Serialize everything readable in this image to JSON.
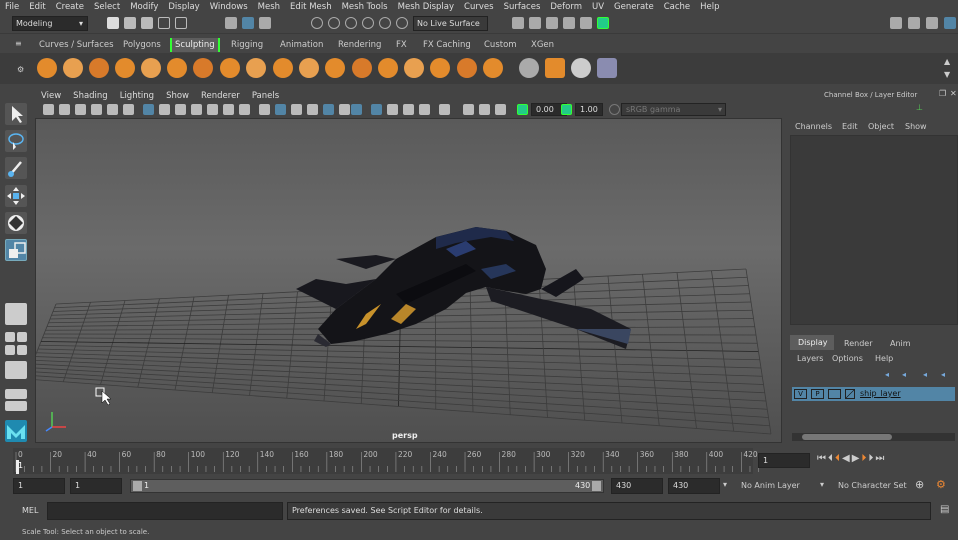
{
  "menu": [
    "File",
    "Edit",
    "Create",
    "Select",
    "Modify",
    "Display",
    "Windows",
    "Mesh",
    "Edit Mesh",
    "Mesh Tools",
    "Mesh Display",
    "Curves",
    "Surfaces",
    "Deform",
    "UV",
    "Generate",
    "Cache",
    "Help"
  ],
  "status": {
    "mode": "Modeling",
    "live_surface": "No Live Surface"
  },
  "shelf_tabs": [
    "Curves / Surfaces",
    "Polygons",
    "Sculpting",
    "Rigging",
    "Animation",
    "Rendering",
    "FX",
    "FX Caching",
    "Custom",
    "XGen"
  ],
  "active_shelf_tab": "Sculpting",
  "panel_menu": [
    "View",
    "Shading",
    "Lighting",
    "Show",
    "Renderer",
    "Panels"
  ],
  "panel_toolbar": {
    "value_a": "0.00",
    "value_b": "1.00",
    "color_space": "sRGB gamma"
  },
  "viewport": {
    "camera_label": "persp"
  },
  "channel_box": {
    "title": "Channel Box / Layer Editor",
    "menu": [
      "Channels",
      "Edit",
      "Object",
      "Show"
    ],
    "tabs": [
      "Display",
      "Render",
      "Anim"
    ],
    "active_tab": "Display",
    "layer_menu": [
      "Layers",
      "Options",
      "Help"
    ],
    "layer": {
      "v": "V",
      "p": "P",
      "name": "ship_layer"
    }
  },
  "timeline": {
    "ticks": [
      "0",
      "20",
      "40",
      "60",
      "80",
      "100",
      "120",
      "140",
      "160",
      "180",
      "200",
      "220",
      "240",
      "260",
      "280",
      "300",
      "320",
      "340",
      "360",
      "380",
      "400",
      "420"
    ],
    "current_frame": "1",
    "frame_field": "1"
  },
  "range": {
    "start": "1",
    "playback_start": "1",
    "slider_start": "1",
    "slider_end": "430",
    "playback_end": "430",
    "end": "430",
    "anim_layer": "No Anim Layer",
    "char_set": "No Character Set"
  },
  "command": {
    "label": "MEL",
    "result": "Preferences saved. See Script Editor for details."
  },
  "help": {
    "text": "Scale Tool: Select an object to scale."
  },
  "colors": {
    "accent_blue": "#5285a6",
    "active_green": "#33ff33",
    "shelf_orange": "#e38b2c"
  }
}
